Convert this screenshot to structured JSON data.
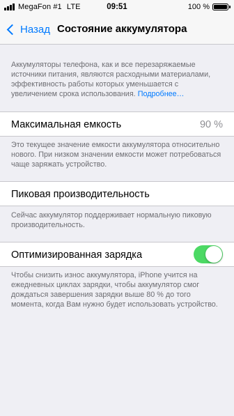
{
  "status_bar": {
    "carrier": "MegaFon #1",
    "network": "LTE",
    "time": "09:51",
    "battery_percent": "100 %"
  },
  "nav": {
    "back_label": "Назад",
    "title": "Состояние аккумулятора"
  },
  "intro": {
    "text": "Аккумуляторы телефона, как и все перезаряжаемые источники питания, являются расходными материалами, эффективность работы которых уменьшается с увеличением срока использования.",
    "link": "Подробнее…"
  },
  "max_capacity": {
    "label": "Максимальная емкость",
    "value": "90 %",
    "footnote": "Это текущее значение емкости аккумулятора относительно нового. При низком значении емкости может потребоваться чаще заряжать устройство."
  },
  "peak_performance": {
    "label": "Пиковая производительность",
    "footnote": "Сейчас аккумулятор поддерживает нормальную пиковую производительность."
  },
  "optimized_charging": {
    "label": "Оптимизированная зарядка",
    "enabled": true,
    "toggle_color": "#4cd964",
    "footnote": "Чтобы снизить износ аккумулятора, iPhone учится на ежедневных циклах зарядки, чтобы аккумулятор смог дождаться завершения зарядки выше 80 % до того момента, когда Вам нужно будет использовать устройство."
  },
  "colors": {
    "accent": "#007aff",
    "background": "#efeff4"
  }
}
